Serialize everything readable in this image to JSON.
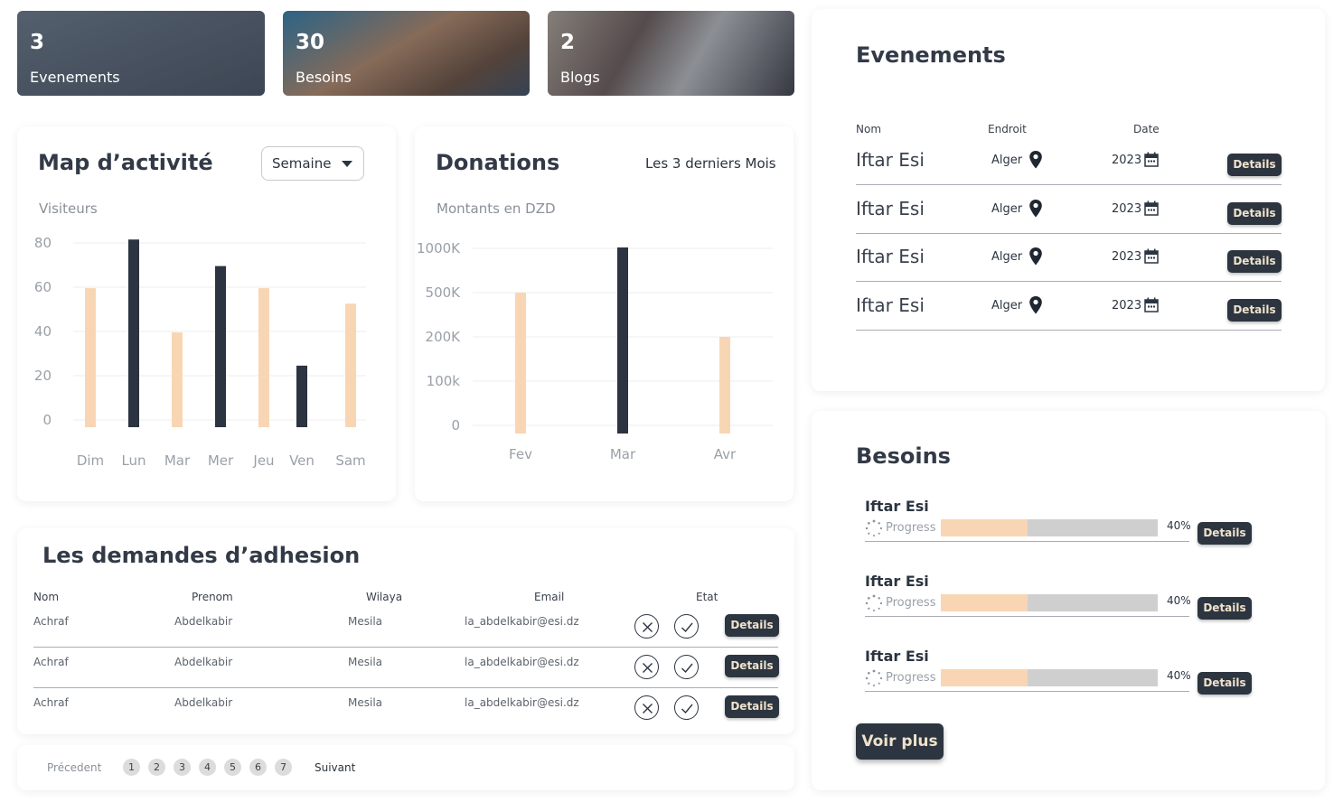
{
  "stats": [
    {
      "count": "3",
      "label": "Evenements"
    },
    {
      "count": "30",
      "label": "Besoins"
    },
    {
      "count": "2",
      "label": "Blogs"
    }
  ],
  "activity_map": {
    "title": "Map d’activité",
    "period_select": "Semaine",
    "subtitle": "Visiteurs",
    "chart_data": {
      "type": "bar",
      "categories": [
        "Dim",
        "Lun",
        "Mar",
        "Mer",
        "Jeu",
        "Ven",
        "Sam"
      ],
      "values": [
        62,
        84,
        42,
        72,
        62,
        27,
        55
      ],
      "ylim": [
        0,
        80
      ],
      "yticks": [
        "80",
        "60",
        "40",
        "20",
        "0"
      ],
      "colors": [
        "#f8d6b4",
        "#2b3440",
        "#f8d6b4",
        "#2b3440",
        "#f8d6b4",
        "#2b3440",
        "#f8d6b4"
      ],
      "grid": true
    }
  },
  "donations": {
    "title": "Donations",
    "period_label": "Les 3 derniers Mois",
    "subtitle": "Montants en DZD",
    "chart_data": {
      "type": "bar",
      "categories": [
        "Fev",
        "Mar",
        "Avr"
      ],
      "values": [
        500,
        1000,
        200
      ],
      "yticks": [
        "1000K",
        "500K",
        "200K",
        "100k",
        "0"
      ],
      "colors": [
        "#f8d6b4",
        "#2b3440",
        "#f8d6b4"
      ],
      "grid": true
    }
  },
  "adhesion": {
    "title": "Les demandes d’adhesion",
    "headers": [
      "Nom",
      "Prenom",
      "Wilaya",
      "Email",
      "Etat"
    ],
    "rows": [
      {
        "nom": "Achraf",
        "prenom": "Abdelkabir",
        "wilaya": "Mesila",
        "email": "la_abdelkabir@esi.dz",
        "details": "Details"
      },
      {
        "nom": "Achraf",
        "prenom": "Abdelkabir",
        "wilaya": "Mesila",
        "email": "la_abdelkabir@esi.dz",
        "details": "Details"
      },
      {
        "nom": "Achraf",
        "prenom": "Abdelkabir",
        "wilaya": "Mesila",
        "email": "la_abdelkabir@esi.dz",
        "details": "Details"
      }
    ]
  },
  "pagination": {
    "prev": "Précedent",
    "next": "Suivant",
    "pages": [
      "1",
      "2",
      "3",
      "4",
      "5",
      "6",
      "7"
    ]
  },
  "events": {
    "title": "Evenements",
    "headers": [
      "Nom",
      "Endroit",
      "Date"
    ],
    "rows": [
      {
        "name": "Iftar Esi",
        "place": "Alger",
        "date": "2023",
        "details": "Details"
      },
      {
        "name": "Iftar Esi",
        "place": "Alger",
        "date": "2023",
        "details": "Details"
      },
      {
        "name": "Iftar Esi",
        "place": "Alger",
        "date": "2023",
        "details": "Details"
      },
      {
        "name": "Iftar Esi",
        "place": "Alger",
        "date": "2023",
        "details": "Details"
      }
    ]
  },
  "needs": {
    "title": "Besoins",
    "items": [
      {
        "name": "Iftar Esi",
        "progress_label": "Progress",
        "percent": "40%",
        "progress": 0.4,
        "details": "Details"
      },
      {
        "name": "Iftar Esi",
        "progress_label": "Progress",
        "percent": "40%",
        "progress": 0.4,
        "details": "Details"
      },
      {
        "name": "Iftar Esi",
        "progress_label": "Progress",
        "percent": "40%",
        "progress": 0.4,
        "details": "Details"
      }
    ],
    "more_label": "Voir plus"
  }
}
